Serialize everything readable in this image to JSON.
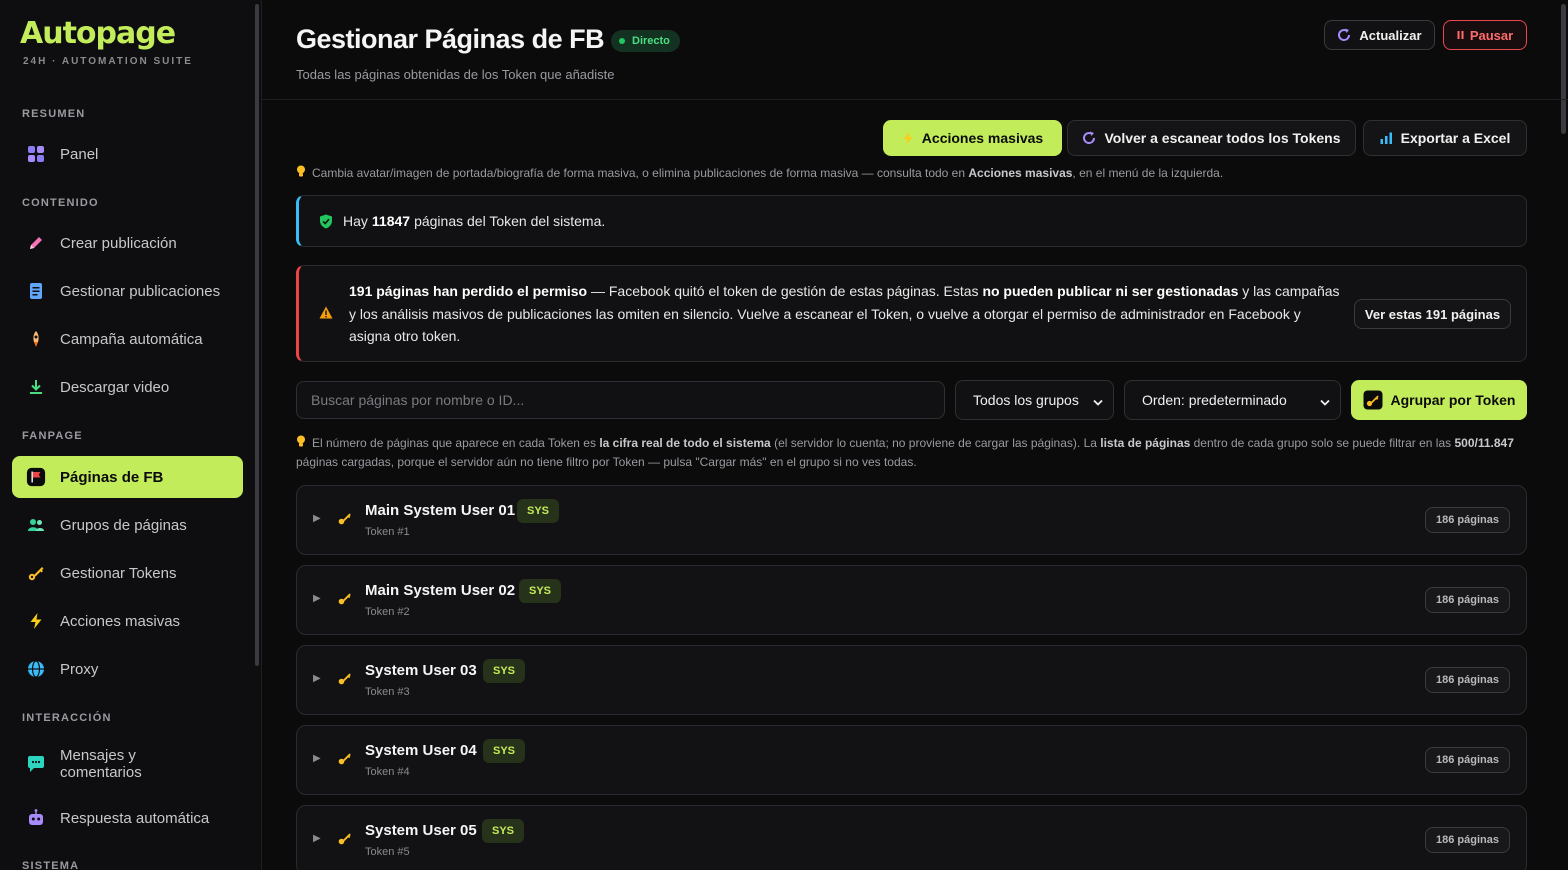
{
  "brand": {
    "name": "Autopage",
    "tagline": "24H · AUTOMATION SUITE"
  },
  "sidebar": {
    "sections": [
      {
        "label": "RESUMEN",
        "items": [
          {
            "label": "Panel",
            "icon": "grid-icon"
          }
        ]
      },
      {
        "label": "CONTENIDO",
        "items": [
          {
            "label": "Crear publicación",
            "icon": "pencil-icon"
          },
          {
            "label": "Gestionar publicaciones",
            "icon": "document-icon"
          },
          {
            "label": "Campaña automática",
            "icon": "rocket-icon"
          },
          {
            "label": "Descargar video",
            "icon": "download-icon"
          }
        ]
      },
      {
        "label": "FANPAGE",
        "items": [
          {
            "label": "Páginas de FB",
            "icon": "flag-icon",
            "active": true
          },
          {
            "label": "Grupos de páginas",
            "icon": "users-icon"
          },
          {
            "label": "Gestionar Tokens",
            "icon": "key-icon"
          },
          {
            "label": "Acciones masivas",
            "icon": "bolt-icon"
          },
          {
            "label": "Proxy",
            "icon": "globe-icon"
          }
        ]
      },
      {
        "label": "INTERACCIÓN",
        "items": [
          {
            "label": "Mensajes y comentarios",
            "icon": "chat-icon"
          },
          {
            "label": "Respuesta automática",
            "icon": "robot-icon"
          }
        ]
      },
      {
        "label": "SISTEMA",
        "items": []
      }
    ]
  },
  "header": {
    "title": "Gestionar Páginas de FB",
    "live_badge": "Directo",
    "subtitle": "Todas las páginas obtenidas de los Token que añadiste",
    "refresh_label": "Actualizar",
    "pause_label": "Pausar"
  },
  "toolbar": {
    "mass_actions_label": "Acciones masivas",
    "rescan_label": "Volver a escanear todos los Tokens",
    "export_label": "Exportar a Excel"
  },
  "hint_top": {
    "pre": "Cambia avatar/imagen de portada/biografía de forma masiva, o elimina publicaciones de forma masiva — consulta todo en ",
    "bold": "Acciones masivas",
    "post": ", en el menú de la izquierda."
  },
  "info_box": {
    "pre": "Hay ",
    "count": "11847",
    "post": " páginas del Token del sistema."
  },
  "warning_box": {
    "bold1": "191 páginas han perdido el permiso",
    "text1": " — Facebook quitó el token de gestión de estas páginas. Estas ",
    "bold2": "no pueden publicar ni ser gestionadas",
    "text2": " y las campañas y los análisis masivos de publicaciones las omiten en silencio. Vuelve a escanear el Token, o vuelve a otorgar el permiso de administrador en Facebook y asigna otro token.",
    "button_label": "Ver estas 191 páginas"
  },
  "filters": {
    "search_placeholder": "Buscar páginas por nombre o ID...",
    "search_value": "",
    "group_select": "Todos los grupos",
    "order_select": "Orden: predeterminado",
    "group_by_label": "Agrupar por Token"
  },
  "hint_bottom": {
    "t1": "El número de páginas que aparece en cada Token es ",
    "b1": "la cifra real de todo el sistema",
    "t2": " (el servidor lo cuenta; no proviene de cargar las páginas). La ",
    "b2": "lista de páginas",
    "t3": " dentro de cada grupo solo se puede filtrar en las ",
    "b3": "500/11.847",
    "t4": " páginas cargadas, porque el servidor aún no tiene filtro por Token — pulsa \"Cargar más\" en el grupo si no ves todas."
  },
  "tokens": [
    {
      "name": "Main System User 01",
      "badge": "SYS",
      "sub": "Token #1",
      "count": "186 páginas"
    },
    {
      "name": "Main System User 02",
      "badge": "SYS",
      "sub": "Token #2",
      "count": "186 páginas"
    },
    {
      "name": "System User 03",
      "badge": "SYS",
      "sub": "Token #3",
      "count": "186 páginas"
    },
    {
      "name": "System User 04",
      "badge": "SYS",
      "sub": "Token #4",
      "count": "186 páginas"
    },
    {
      "name": "System User 05",
      "badge": "SYS",
      "sub": "Token #5",
      "count": "186 páginas"
    }
  ],
  "colors": {
    "accent": "#c3ec5b",
    "danger": "#ef4444",
    "info": "#38bdf8",
    "live": "#22c55e"
  }
}
